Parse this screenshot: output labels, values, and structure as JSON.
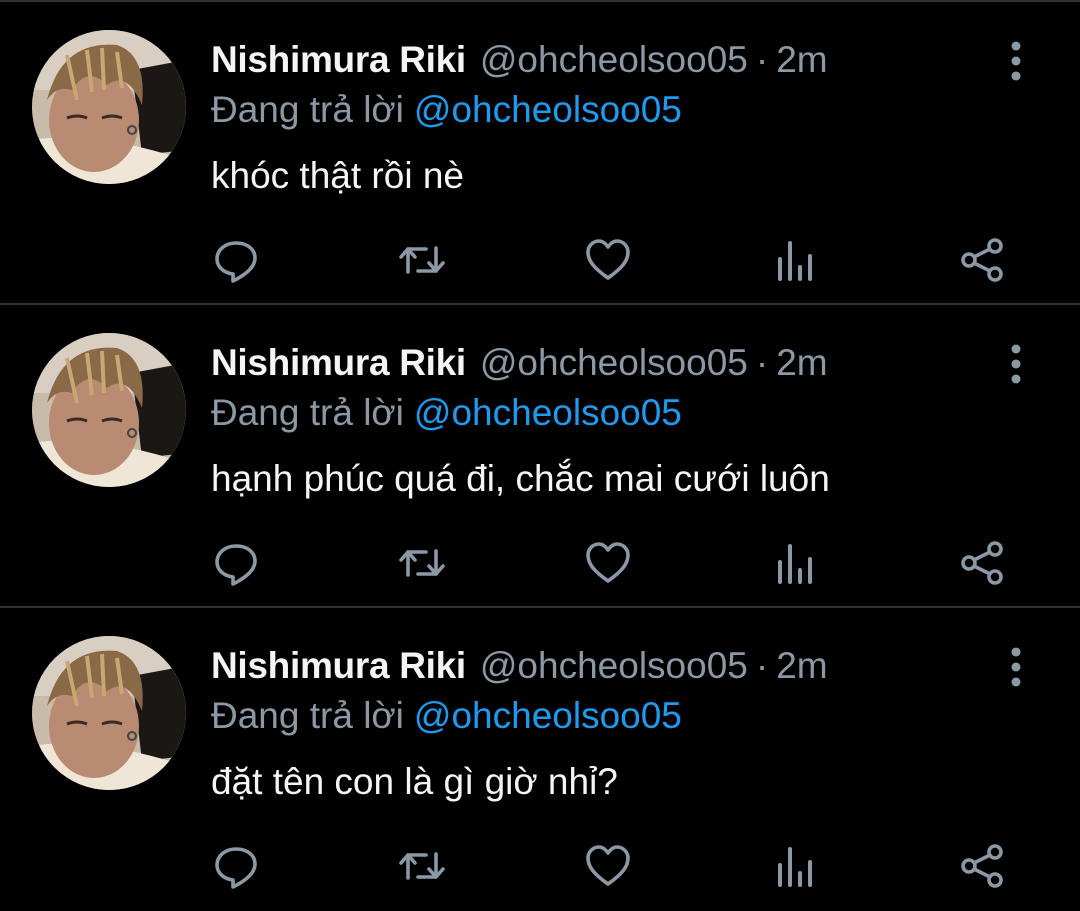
{
  "tweets": [
    {
      "name": "Nishimura Riki",
      "handle": "@ohcheolsoo05",
      "separator": "·",
      "time": "2m",
      "reply_prefix": "Đang trả lời",
      "reply_to": "@ohcheolsoo05",
      "text": "khóc thật rồi nè"
    },
    {
      "name": "Nishimura Riki",
      "handle": "@ohcheolsoo05",
      "separator": "·",
      "time": "2m",
      "reply_prefix": "Đang trả lời",
      "reply_to": "@ohcheolsoo05",
      "text": "hạnh phúc quá đi, chắc mai cưới luôn"
    },
    {
      "name": "Nishimura Riki",
      "handle": "@ohcheolsoo05",
      "separator": "·",
      "time": "2m",
      "reply_prefix": "Đang trả lời",
      "reply_to": "@ohcheolsoo05",
      "text": "đặt tên con là gì giờ nhỉ?"
    }
  ],
  "icons": {
    "more": "more-vertical-icon",
    "reply": "reply-bubble-icon",
    "retweet": "retweet-icon",
    "like": "heart-icon",
    "views": "bar-chart-icon",
    "share": "share-icon"
  },
  "colors": {
    "background": "#000000",
    "name": "#f5f5f5",
    "secondary": "#8b98a5",
    "link": "#1d9bf0",
    "divider": "#2f3336",
    "icon": "#8b98a5"
  }
}
